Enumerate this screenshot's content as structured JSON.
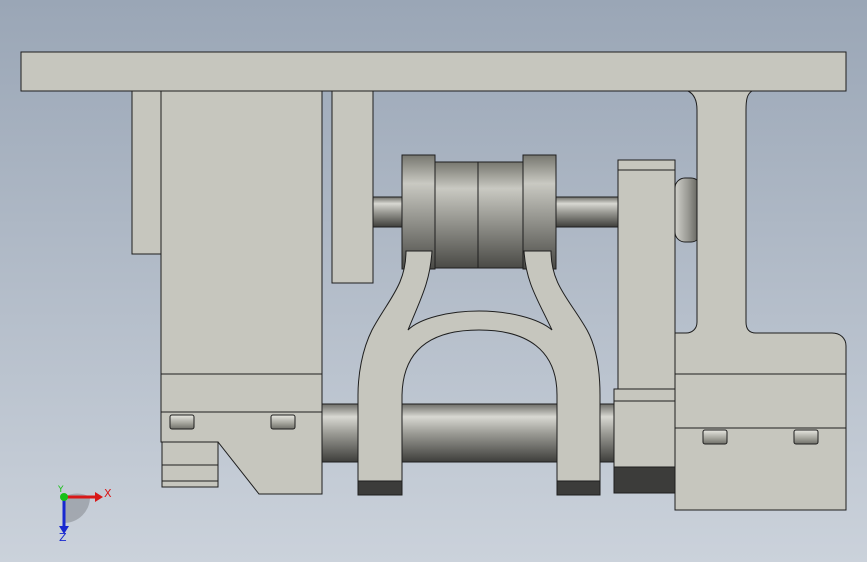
{
  "viewport": {
    "background_top": "#9aa6b6",
    "background_bottom": "#cbd2db",
    "part_fill": "#c6c6be",
    "part_stroke": "#1e1e1e",
    "dark_fill": "#3c3c3a"
  },
  "triad": {
    "x_label": "X",
    "y_label": "Y",
    "z_label": "Z",
    "x_color": "#d81818",
    "y_color": "#18c018",
    "z_color": "#1828d0"
  }
}
